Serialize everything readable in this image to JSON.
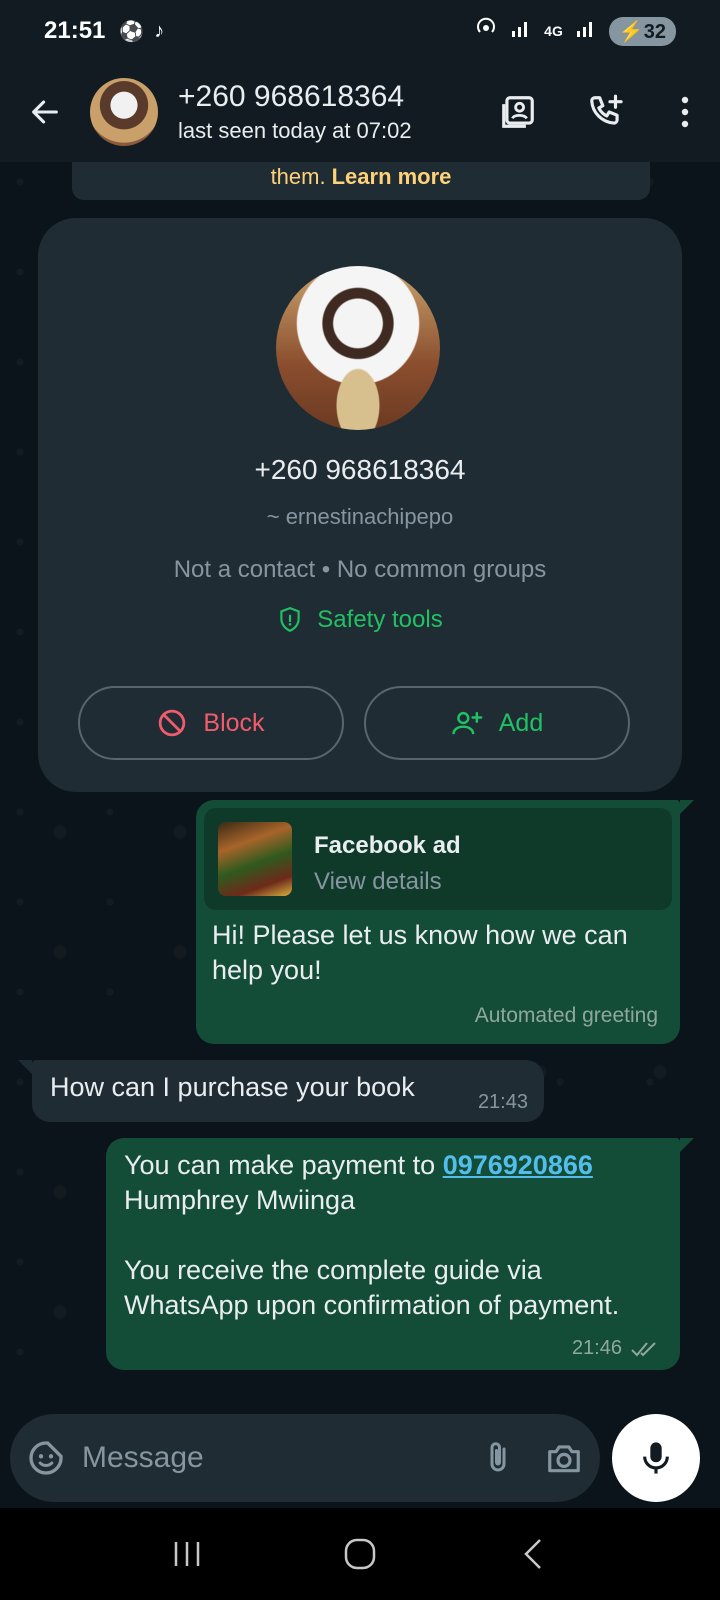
{
  "status_bar": {
    "time": "21:51",
    "network": "4G",
    "battery": "32"
  },
  "header": {
    "contact_number": "+260 968618364",
    "last_seen": "last seen today at 07:02"
  },
  "encryption_note": {
    "text": "them.",
    "link": "Learn more"
  },
  "profile_card": {
    "number": "+260 968618364",
    "username": "~ ernestinachipepo",
    "meta": "Not a contact • No common groups",
    "safety_tools": "Safety tools",
    "block_label": "Block",
    "add_label": "Add"
  },
  "messages": {
    "ad": {
      "title": "Facebook ad",
      "subtitle": "View details",
      "text": "Hi! Please let us know how we can help you!",
      "footer": "Automated greeting"
    },
    "incoming": {
      "text": "How can I purchase your book",
      "time": "21:43"
    },
    "reply": {
      "line1_prefix": "You can make payment to ",
      "phone_link": "0976920866",
      "line2": "Humphrey Mwiinga",
      "line3": "You receive the complete guide via WhatsApp upon confirmation of payment.",
      "time": "21:46"
    }
  },
  "input": {
    "placeholder": "Message"
  },
  "colors": {
    "accent_green": "#21c063",
    "outgoing_bubble": "#134d37",
    "incoming_bubble": "#1f2c34",
    "block_red": "#f15c6d",
    "link_blue": "#53bdeb"
  }
}
